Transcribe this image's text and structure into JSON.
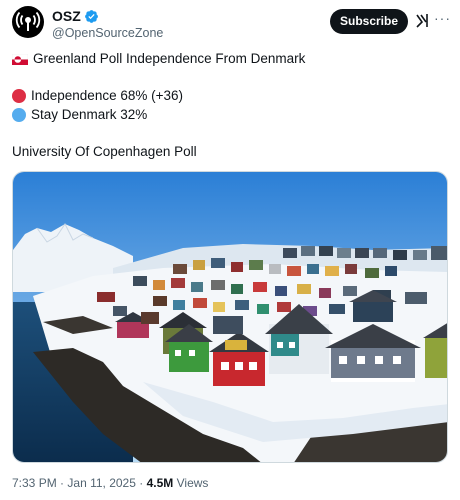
{
  "post": {
    "author": {
      "display_name": "OSZ",
      "handle": "@OpenSourceZone",
      "avatar_icon": "broadcast-icon",
      "verified": true
    },
    "actions": {
      "subscribe_label": "Subscribe",
      "grok_icon": "grok-icon",
      "more_icon": "more-icon"
    },
    "body": {
      "headline": "Greenland Poll Independence From Denmark",
      "flag_icon": "greenland-flag-icon",
      "results": [
        {
          "label": "Independence 68% (+36)",
          "color": "#dd2e44"
        },
        {
          "label": "Stay Denmark 32%",
          "color": "#55acee"
        }
      ],
      "source": "University Of Copenhagen Poll"
    },
    "media": {
      "description_icon": "photo-icon"
    },
    "meta": {
      "time": "7:33 PM",
      "separator": "·",
      "date": "Jan 11, 2025",
      "views_count": "4.5M",
      "views_label": "Views"
    },
    "colors": {
      "text": "#0f1419",
      "secondary": "#536471",
      "verified": "#1d9bf0"
    }
  }
}
